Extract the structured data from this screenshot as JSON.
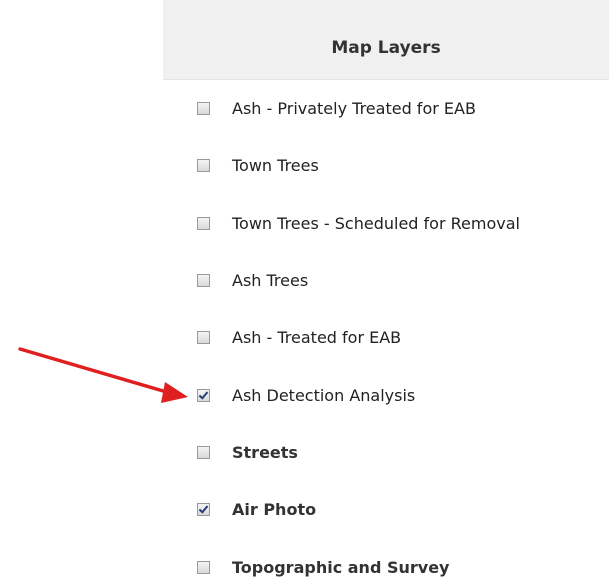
{
  "panel": {
    "title": "Map Layers",
    "layers": [
      {
        "label": "Ash - Privately Treated for EAB",
        "checked": false,
        "bold": false
      },
      {
        "label": "Town Trees",
        "checked": false,
        "bold": false
      },
      {
        "label": "Town Trees - Scheduled for Removal",
        "checked": false,
        "bold": false
      },
      {
        "label": "Ash Trees",
        "checked": false,
        "bold": false
      },
      {
        "label": "Ash - Treated for EAB",
        "checked": false,
        "bold": false
      },
      {
        "label": "Ash Detection Analysis",
        "checked": true,
        "bold": false
      },
      {
        "label": "Streets",
        "checked": false,
        "bold": true
      },
      {
        "label": "Air Photo",
        "checked": true,
        "bold": true
      },
      {
        "label": "Topographic and Survey",
        "checked": false,
        "bold": true
      }
    ]
  },
  "annotation": {
    "arrow_color": "#e02020",
    "icon": "arrow-pointer-icon"
  }
}
